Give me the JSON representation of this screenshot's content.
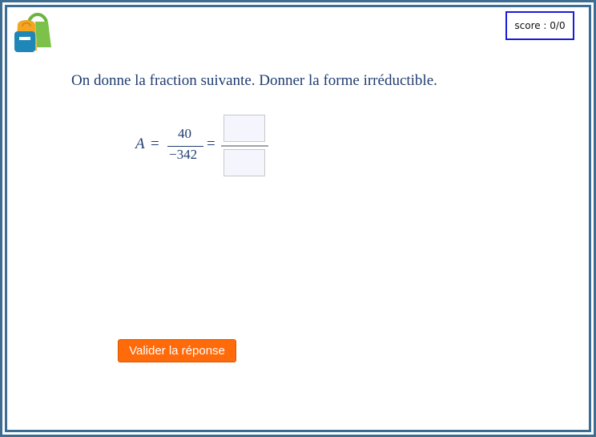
{
  "score": {
    "label": "score : 0/0"
  },
  "logo": {
    "icon": "backpack-icon"
  },
  "question": {
    "text": "On donne la fraction suivante. Donner la forme irréductible."
  },
  "fraction": {
    "variable": "A",
    "equals": "=",
    "numerator": "40",
    "denominator": "−342"
  },
  "answer": {
    "numerator_value": "",
    "denominator_value": ""
  },
  "actions": {
    "validate_label": "Valider la réponse"
  },
  "colors": {
    "frame": "#3d6d92",
    "text": "#1f3c70",
    "button": "#ff6a0a",
    "score_border": "#1a1adc"
  }
}
